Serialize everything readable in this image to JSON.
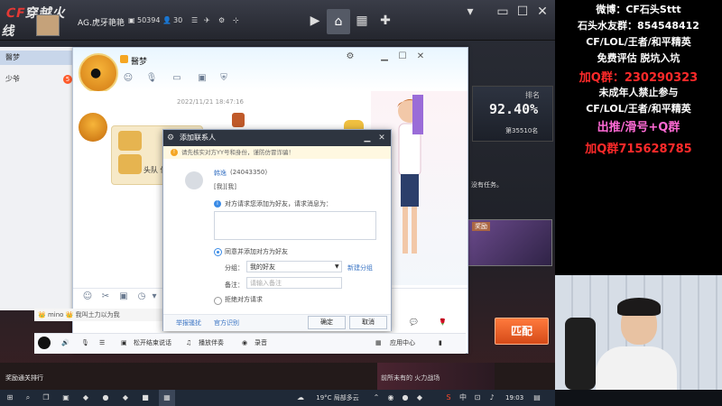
{
  "game": {
    "logo_cf": "CF",
    "logo_text": "穿越火线",
    "username": "AG.虎牙艳艳",
    "coins": "50394",
    "friends_count": "30",
    "rank_label": "排名",
    "rank_percent": "92.40%",
    "rank_number": "第35510名",
    "task_text": "没有任务。",
    "event_label": "奖励",
    "match_button": "匹配",
    "bottom_label": "奖励通关排行",
    "ad_text": "前所未有的 火力战场"
  },
  "contacts": [
    {
      "name": "醫梦"
    },
    {
      "name": "少爷",
      "badge": "5"
    }
  ],
  "chat": {
    "contact_name": "醫梦",
    "timestamp": "2022/11/21 18:47:16",
    "message_text": "头队 你",
    "group_notice": "👑 mino 👑 我叫土力以为我"
  },
  "dialog": {
    "title": "添加联系人",
    "warning": "请先核实对方YY号和身份，谨防仿冒诈骗！",
    "target_name": "韩逸",
    "target_id": "(24043350)",
    "target_extra": "[我][我]",
    "verify_label": "对方请求您添加为好友，请求消息为：",
    "agree_label": "同意并添加对方为好友",
    "group_label": "分组：",
    "group_value": "我的好友",
    "new_group": "新建分组",
    "remark_label": "备注：",
    "remark_placeholder": "请输入备注",
    "refuse_label": "拒绝对方请求",
    "report_link": "举报骚扰",
    "official_link": "官方识别",
    "confirm": "确定",
    "cancel": "取消"
  },
  "voicebar": {
    "push_to_talk": "松开结束说话",
    "accompany": "播放伴奏",
    "record": "录音",
    "app_center": "应用中心"
  },
  "overlay": {
    "line1": "微博：CF石头Sttt",
    "line2": "石头水友群：854548412",
    "line3": "CF/LOL/王者/和平精英",
    "line4": "免费评估 脱坑入坑",
    "line5": "加Q群：230290323",
    "line6": "未成年人禁止参与",
    "line7": "CF/LOL/王者/和平精英",
    "line8": "出推/滑号+Q群",
    "line9": "加Q群715628785"
  },
  "taskbar": {
    "weather": "19°C 局部多云",
    "time": "19:03"
  }
}
